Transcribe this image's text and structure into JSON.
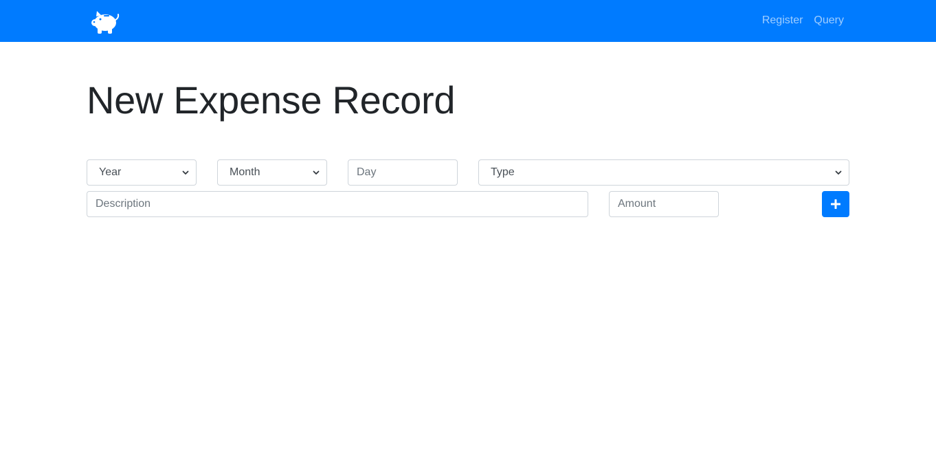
{
  "navbar": {
    "brand_icon": "piggy-bank-icon",
    "links": [
      {
        "label": "Register"
      },
      {
        "label": "Query"
      }
    ],
    "background": "#007bff"
  },
  "page": {
    "title": "New Expense Record"
  },
  "form": {
    "year": {
      "selected": "Year"
    },
    "month": {
      "selected": "Month"
    },
    "day": {
      "placeholder": "Day",
      "value": ""
    },
    "type": {
      "selected": "Type"
    },
    "description": {
      "placeholder": "Description",
      "value": ""
    },
    "amount": {
      "placeholder": "Amount",
      "value": ""
    },
    "add_button": {
      "icon": "plus-icon"
    }
  },
  "colors": {
    "accent": "#007bff",
    "input_border": "#ced4da",
    "nav_link": "rgba(255,255,255,0.62)"
  }
}
